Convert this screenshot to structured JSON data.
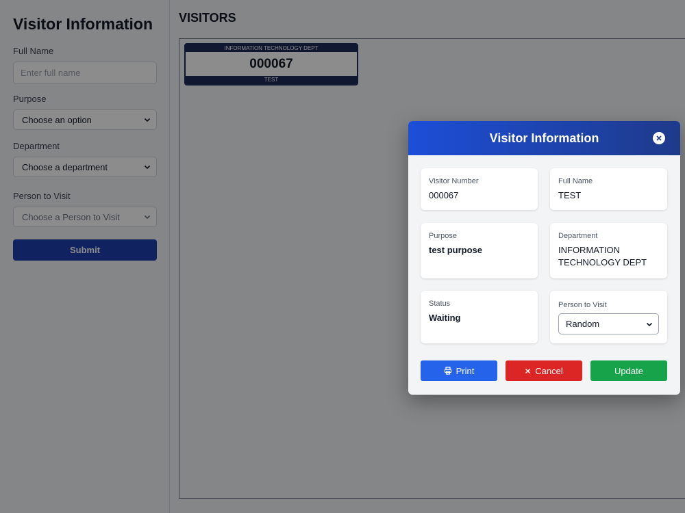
{
  "sidebar": {
    "title": "Visitor Information",
    "full_name": {
      "label": "Full Name",
      "placeholder": "Enter full name"
    },
    "purpose": {
      "label": "Purpose",
      "value": "Choose an option"
    },
    "department": {
      "label": "Department",
      "value": "Choose a department"
    },
    "person": {
      "label": "Person to Visit",
      "value": "Choose a Person to Visit"
    },
    "submit_label": "Submit"
  },
  "main": {
    "title": "VISITORS",
    "ticket": {
      "department": "INFORMATION TECHNOLOGY DEPT",
      "number": "000067",
      "name": "TEST"
    }
  },
  "modal": {
    "title": "Visitor Information",
    "visitor_number": {
      "label": "Visitor Number",
      "value": "000067"
    },
    "full_name": {
      "label": "Full Name",
      "value": "TEST"
    },
    "purpose": {
      "label": "Purpose",
      "value": "test purpose"
    },
    "department": {
      "label": "Department",
      "value_line1": "INFORMATION",
      "value_line2": "TECHNOLOGY DEPT"
    },
    "status": {
      "label": "Status",
      "value": "Waiting"
    },
    "person": {
      "label": "Person to Visit",
      "value": "Random"
    },
    "buttons": {
      "print": "Print",
      "cancel": "Cancel",
      "update": "Update"
    }
  },
  "colors": {
    "primary": "#1e40af",
    "header_gradient_start": "#1d4ed8",
    "header_gradient_end": "#1e3a8a",
    "print": "#2563eb",
    "cancel": "#dc2626",
    "update": "#16a34a"
  }
}
